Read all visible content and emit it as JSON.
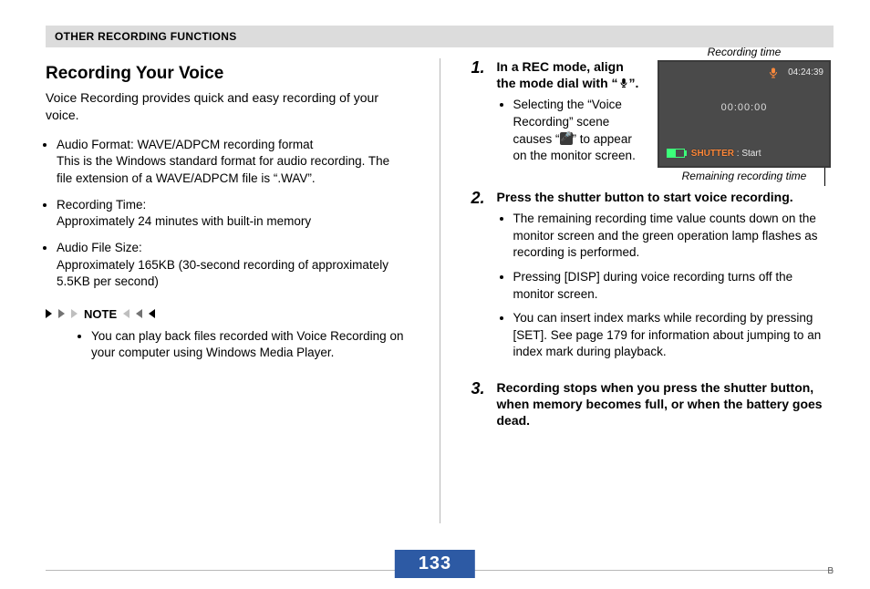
{
  "header": {
    "section": "OTHER RECORDING FUNCTIONS"
  },
  "left": {
    "title": "Recording Your Voice",
    "intro": "Voice Recording provides quick and easy recording of your voice.",
    "specs": [
      "Audio Format: WAVE/ADPCM recording format\nThis is the Windows standard format for audio recording. The file extension of a WAVE/ADPCM file is “.WAV”.",
      "Recording Time:\nApproximately 24 minutes with built-in memory",
      "Audio File Size:\nApproximately 165KB (30-second recording of approximately 5.5KB per second)"
    ],
    "note_label": "NOTE",
    "note_items": [
      "You can play back files recorded with Voice Recording on your computer using Windows Media Player."
    ]
  },
  "right": {
    "steps": [
      {
        "num": "1.",
        "title_pre": "In a REC mode, align the mode dial with “",
        "title_post": "”.",
        "sub_pre": "Selecting the “Voice Recording” scene causes “",
        "sub_post": "” to appear on the monitor screen."
      },
      {
        "num": "2.",
        "title": "Press the shutter button to start voice recording.",
        "subs": [
          "The remaining recording time value counts down on the monitor screen and the green operation lamp flashes as recording is performed.",
          "Pressing [DISP] during voice recording turns off the monitor screen.",
          "You can insert index marks while recording by pressing [SET]. See page 179 for information about jumping to an index mark during playback."
        ]
      },
      {
        "num": "3.",
        "title": "Recording stops when you press the shutter button, when memory becomes full, or when the battery goes dead."
      }
    ],
    "figure": {
      "caption_top": "Recording time",
      "caption_bottom": "Remaining recording time",
      "screen": {
        "elapsed": "00:00:00",
        "remaining": "04:24:39",
        "shutter_label": "SHUTTER",
        "start_label": ": Start"
      }
    }
  },
  "footer": {
    "page": "133",
    "tail": "B"
  },
  "icons": {
    "mic": "mic-icon",
    "mic_box": "mic-box-icon"
  }
}
